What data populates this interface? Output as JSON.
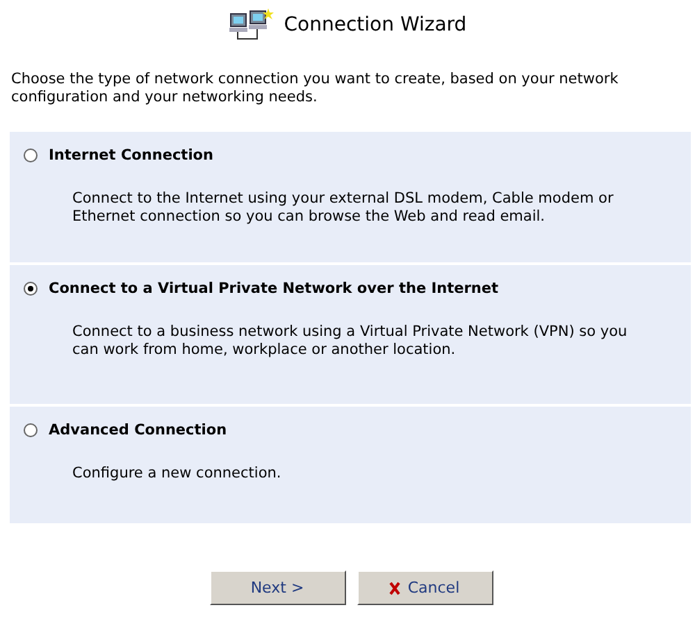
{
  "title": "Connection Wizard",
  "intro": "Choose the type of network connection you want to create, based on your network configuration and your networking needs.",
  "options": [
    {
      "label": "Internet Connection",
      "selected": false,
      "description": "Connect to the Internet using your external DSL modem, Cable modem or Ethernet connection so you can browse the Web and read email."
    },
    {
      "label": "Connect to a Virtual Private Network over the Internet",
      "selected": true,
      "description": "Connect to a business network using a Virtual Private Network (VPN) so you can work from home, workplace or another location."
    },
    {
      "label": "Advanced Connection",
      "selected": false,
      "description": "Configure a new connection."
    }
  ],
  "buttons": [
    {
      "label": "Next >",
      "kind": "next"
    },
    {
      "label": "Cancel",
      "kind": "cancel"
    }
  ]
}
